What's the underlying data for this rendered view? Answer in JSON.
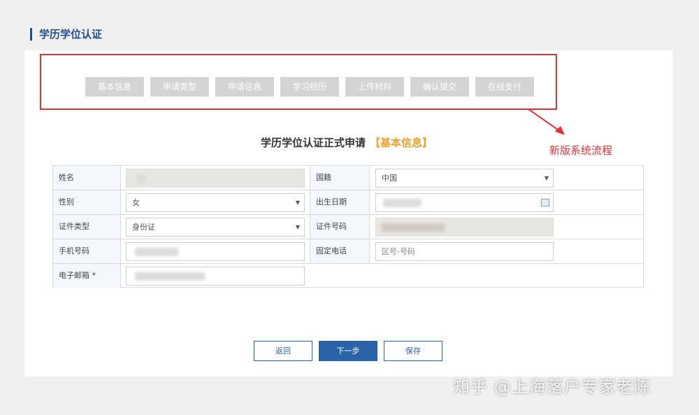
{
  "header": {
    "title": "学历学位认证"
  },
  "steps": [
    {
      "label": "基本信息"
    },
    {
      "label": "申请类型"
    },
    {
      "label": "申请信息"
    },
    {
      "label": "学习经历"
    },
    {
      "label": "上传材料"
    },
    {
      "label": "确认提交"
    },
    {
      "label": "在线支付"
    }
  ],
  "annotation": {
    "text": "新版系统流程"
  },
  "form": {
    "heading": "学历学位认证正式申请",
    "heading_accent": "【基本信息】",
    "rows": [
      {
        "left_label": "姓名",
        "left_value": "",
        "right_label": "国籍",
        "right_value": "中国"
      },
      {
        "left_label": "性别",
        "left_value": "女",
        "right_label": "出生日期",
        "right_value": ""
      },
      {
        "left_label": "证件类型",
        "left_value": "身份证",
        "right_label": "证件号码",
        "right_value": ""
      },
      {
        "left_label": "手机号码",
        "left_value": "",
        "right_label": "固定电话",
        "right_placeholder": "区号-号码"
      },
      {
        "left_label": "电子邮箱 *",
        "left_value": ""
      }
    ]
  },
  "buttons": {
    "back": "返回",
    "next": "下一步",
    "save": "保存"
  },
  "watermark": {
    "text": "知乎 @上海落户专家老陈"
  },
  "colors": {
    "primary": "#2b63a8",
    "annotation": "#e0323a",
    "accent": "#f0a030"
  }
}
